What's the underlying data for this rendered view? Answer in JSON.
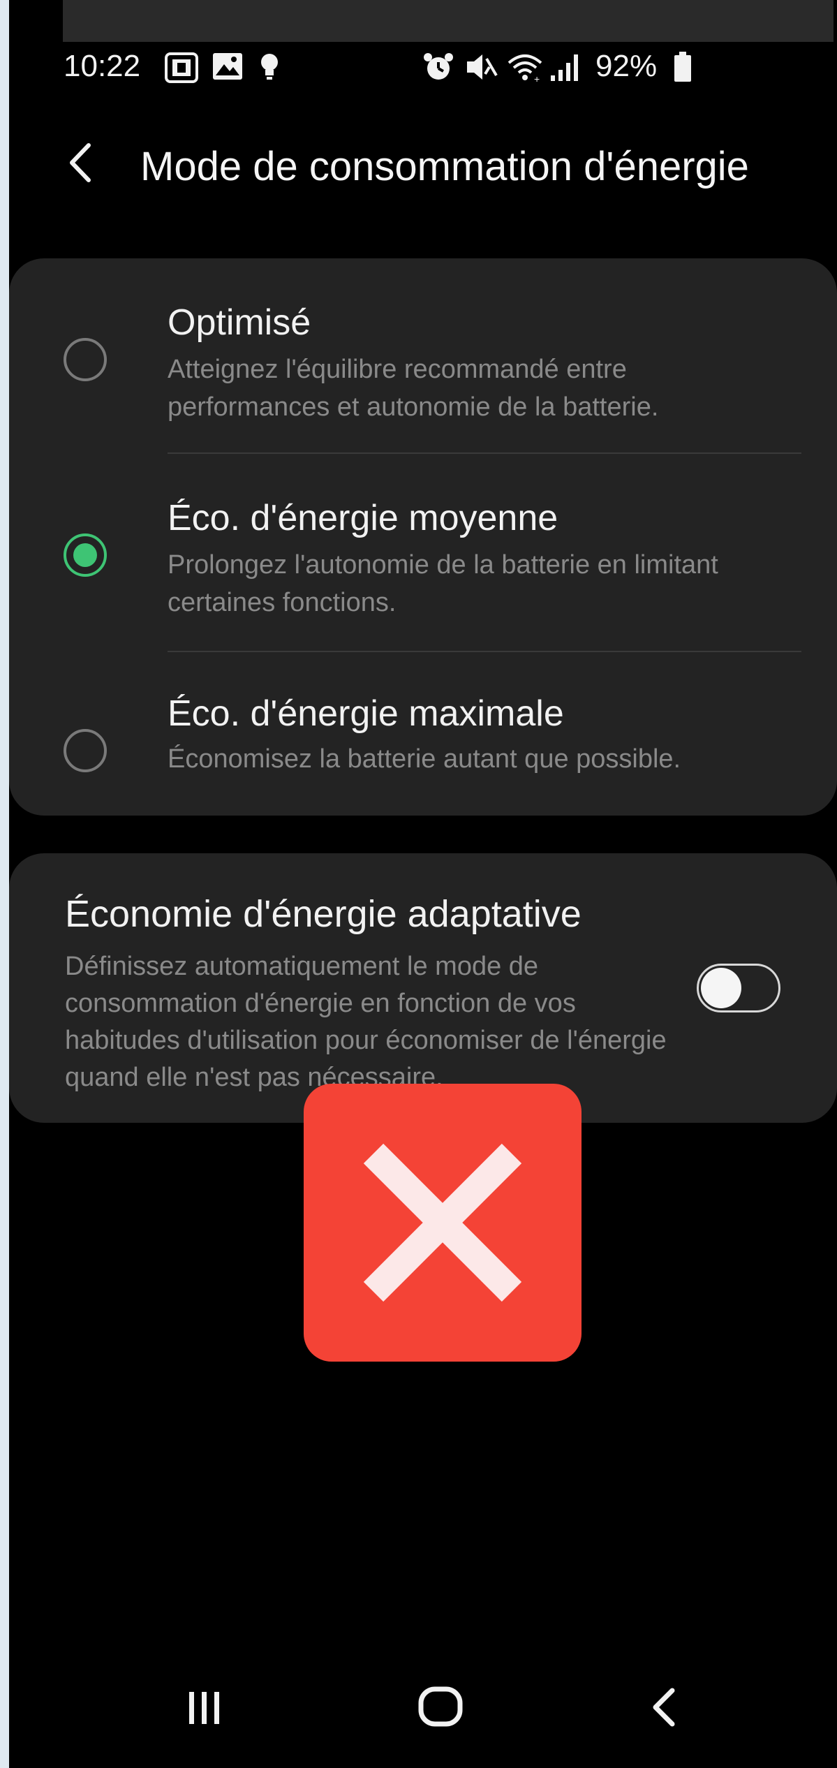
{
  "status_bar": {
    "time": "10:22",
    "battery_percent": "92%",
    "icons": [
      "sim-card-icon",
      "image-icon",
      "bulb-icon",
      "alarm-icon",
      "mute-icon",
      "wifi-icon",
      "signal-icon",
      "battery-icon"
    ]
  },
  "header": {
    "back_icon": "chevron-left-icon",
    "title": "Mode de consommation d'énergie"
  },
  "modes": [
    {
      "title": "Optimisé",
      "description": "Atteignez l'équilibre recommandé entre performances et autonomie de la batterie.",
      "selected": false
    },
    {
      "title": "Éco. d'énergie moyenne",
      "description": "Prolongez l'autonomie de la batterie en limitant certaines fonctions.",
      "selected": true
    },
    {
      "title": "Éco. d'énergie maximale",
      "description": "Économisez la batterie autant que possible.",
      "selected": false
    }
  ],
  "adaptive": {
    "title": "Économie d'énergie adaptative",
    "description": "Définissez automatiquement le mode de consommation d'énergie en fonction de vos habitudes d'utilisation pour économiser de l'énergie quand elle n'est pas nécessaire.",
    "enabled": false
  },
  "overlay": {
    "icon": "close-icon"
  },
  "nav_bar": {
    "icons": [
      "recent-apps-icon",
      "home-icon",
      "back-icon"
    ]
  },
  "colors": {
    "background": "#000000",
    "card": "#232323",
    "accent": "#3ec474",
    "error": "#f44336",
    "text_primary": "#f2f2f2",
    "text_secondary": "#8a8a8a"
  }
}
